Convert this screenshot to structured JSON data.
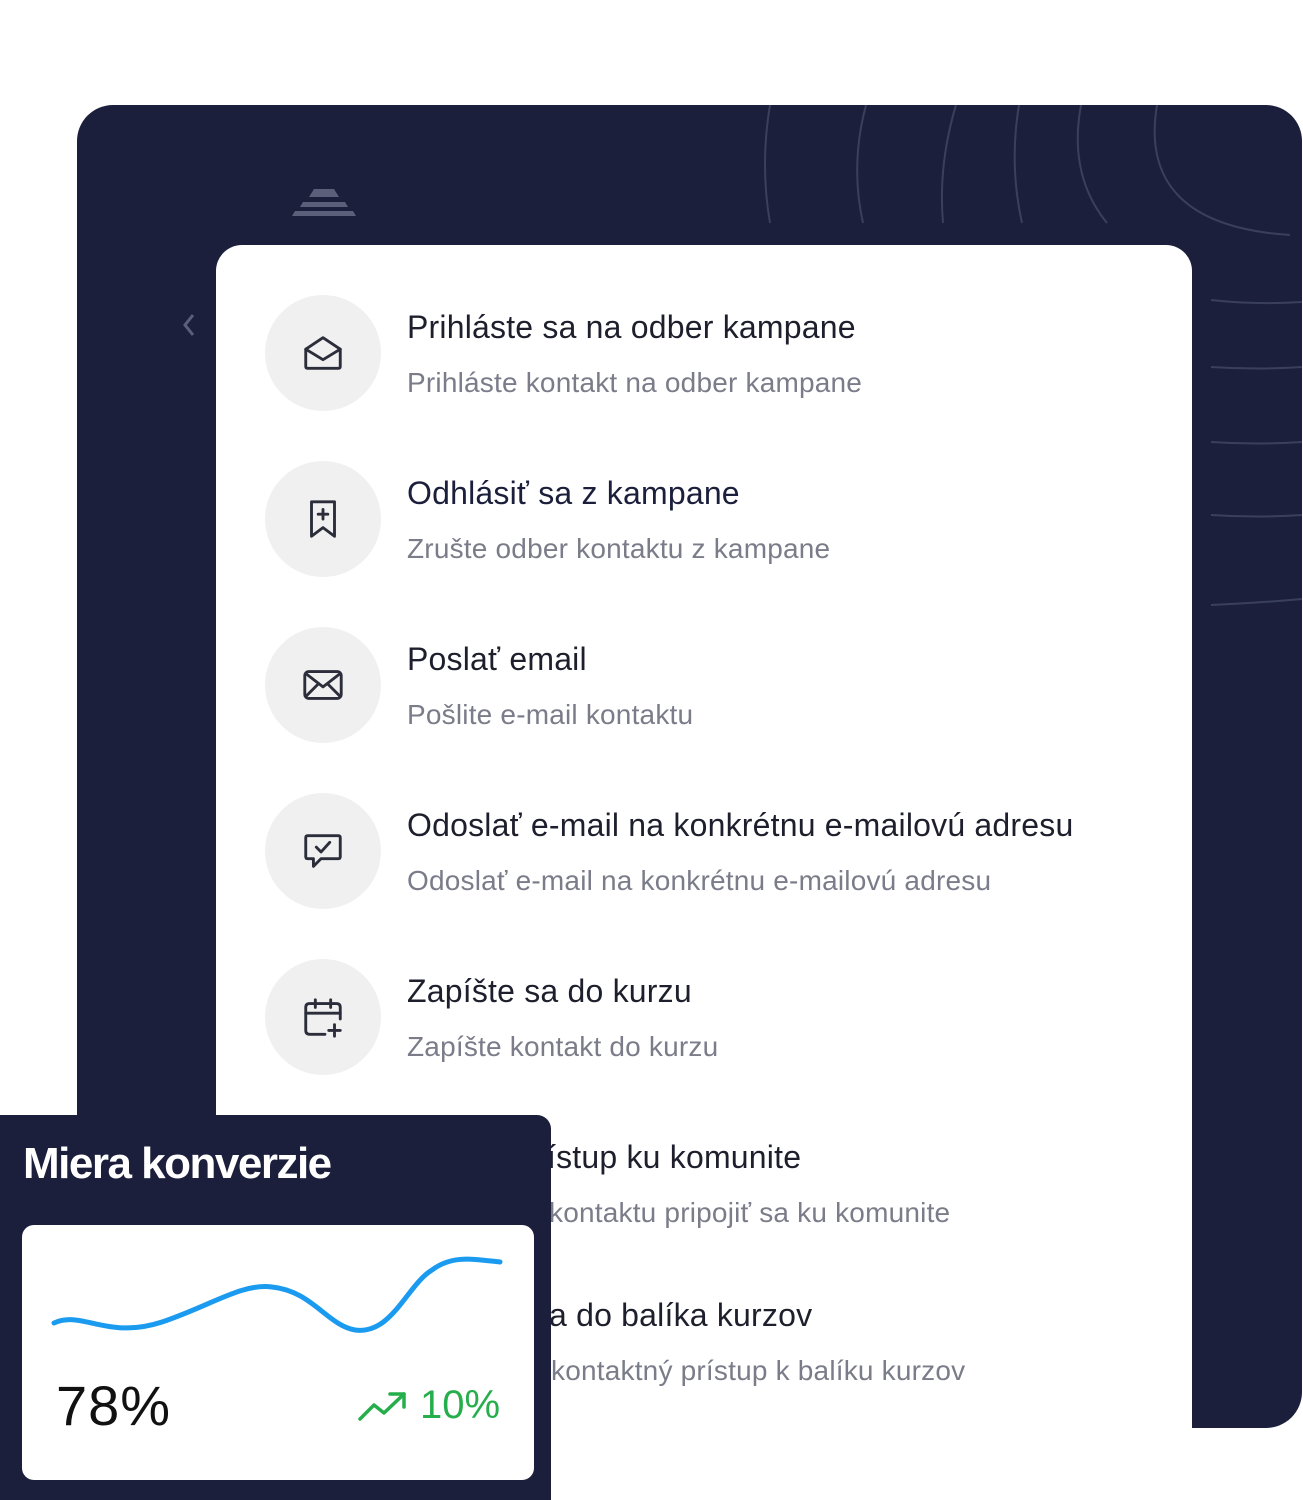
{
  "actions": [
    {
      "title": "Prihláste sa na odber kampane",
      "description": "Prihláste kontakt na odber kampane",
      "icon": "envelope-open-icon"
    },
    {
      "title": "Odhlásiť sa z kampane",
      "description": "Zrušte odber kontaktu z kampane",
      "icon": "bookmark-plus-icon"
    },
    {
      "title": "Poslať email",
      "description": "Pošlite e-mail kontaktu",
      "icon": "envelope-icon"
    },
    {
      "title": "Odoslať e-mail na konkrétnu e-mailovú adresu",
      "description": "Odoslať e-mail na konkrétnu e-mailovú adresu",
      "icon": "message-check-icon"
    },
    {
      "title": "Zapíšte sa do kurzu",
      "description": "Zapíšte kontakt do kurzu",
      "icon": "calendar-plus-icon"
    },
    {
      "title": "ístup ku komunite",
      "description": "kontaktu pripojiť sa ku komunite",
      "icon": ""
    },
    {
      "title": "a do balíka kurzov",
      "description": "kontaktný prístup k balíku kurzov",
      "icon": ""
    }
  ],
  "conversion": {
    "title": "Miera konverzie",
    "value": "78%",
    "change": "10%",
    "trend_icon": "trend-up-icon",
    "line_color": "#1a9bf0",
    "change_color": "#27ae4c"
  },
  "colors": {
    "navy": "#1b1f3b",
    "card": "#ffffff",
    "icon_bg": "#f0f0f1",
    "title_text": "#1d1f2c",
    "desc_text": "#7a7c89"
  }
}
